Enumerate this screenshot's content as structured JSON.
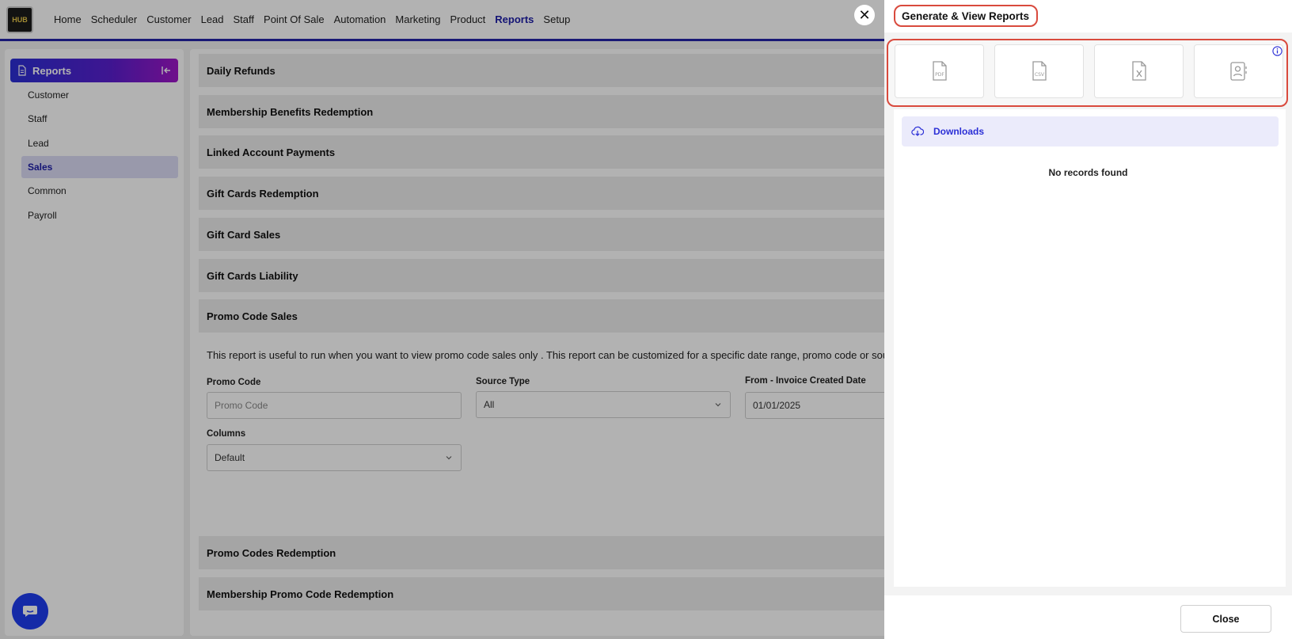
{
  "nav": {
    "logo_text": "HUB",
    "links": [
      "Home",
      "Scheduler",
      "Customer",
      "Lead",
      "Staff",
      "Point Of Sale",
      "Automation",
      "Marketing",
      "Product",
      "Reports",
      "Setup"
    ],
    "active": "Reports"
  },
  "sidebar": {
    "title": "Reports",
    "items": [
      "Customer",
      "Staff",
      "Lead",
      "Sales",
      "Common",
      "Payroll"
    ],
    "active": "Sales"
  },
  "main": {
    "accordions": [
      "Daily Refunds",
      "Membership Benefits Redemption",
      "Linked Account Payments",
      "Gift Cards Redemption",
      "Gift Card Sales",
      "Gift Cards Liability",
      "Promo Code Sales",
      "Promo Codes Redemption",
      "Membership Promo Code Redemption"
    ],
    "description": "This report is useful to run when you want to view promo code sales only . This report can be customized for a specific date range, promo code or source type",
    "form": {
      "promo_code_label": "Promo Code",
      "promo_code_placeholder": "Promo Code",
      "source_type_label": "Source Type",
      "source_type_value": "All",
      "from_date_label": "From - Invoice Created Date",
      "from_date_value": "01/01/2025",
      "columns_label": "Columns",
      "columns_value": "Default"
    }
  },
  "panel": {
    "title": "Generate & View Reports",
    "formats": [
      "pdf-icon",
      "csv-icon",
      "excel-icon",
      "contact-report-icon"
    ],
    "downloads_label": "Downloads",
    "empty_text": "No records found",
    "close_label": "Close"
  },
  "colors": {
    "accent": "#1d1da8",
    "highlight": "#d94a3d",
    "chat": "#1f3df0"
  }
}
